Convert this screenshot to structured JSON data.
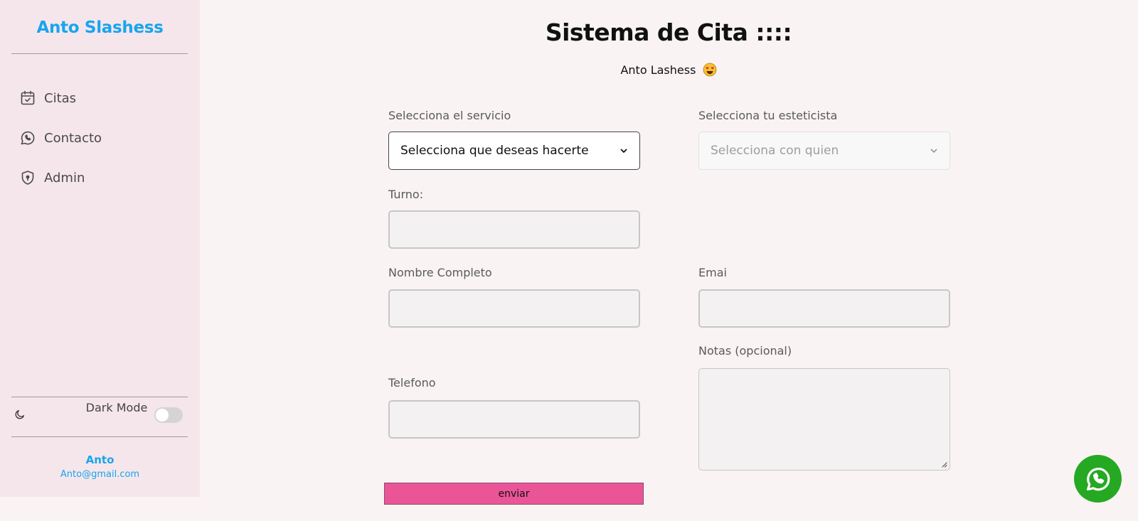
{
  "sidebar": {
    "brand": "Anto Slashess",
    "items": [
      {
        "label": "Citas",
        "icon": "calendar-check-icon"
      },
      {
        "label": "Contacto",
        "icon": "whatsapp-icon"
      },
      {
        "label": "Admin",
        "icon": "shield-icon"
      }
    ],
    "dark_mode": {
      "label": "Dark Mode",
      "enabled": false,
      "icon": "moon-icon"
    },
    "user": {
      "name": "Anto",
      "email": "Anto@gmail.com"
    }
  },
  "main": {
    "title": "Sistema de Cita ::::",
    "subtitle": "Anto Lashess",
    "subtitle_emoji": "heart-eyes-emoji",
    "form": {
      "service": {
        "label": "Selecciona el servicio",
        "value": "Selecciona que deseas hacerte"
      },
      "stylist": {
        "label": "Selecciona tu esteticista",
        "value": "Selecciona con quien"
      },
      "turn": {
        "label": "Turno:",
        "value": ""
      },
      "full_name": {
        "label": "Nombre Completo",
        "value": ""
      },
      "email": {
        "label": "Emai",
        "value": ""
      },
      "notes": {
        "label": "Notas (opcional)",
        "value": ""
      },
      "phone": {
        "label": "Telefono",
        "value": ""
      },
      "submit_label": "enviar"
    }
  },
  "floating": {
    "whatsapp_icon": "whatsapp-icon",
    "color": "#25a923"
  },
  "colors": {
    "brand": "#18a5ee",
    "submit": "#ea5598",
    "sidebar_bg": "#f5e6eb"
  }
}
